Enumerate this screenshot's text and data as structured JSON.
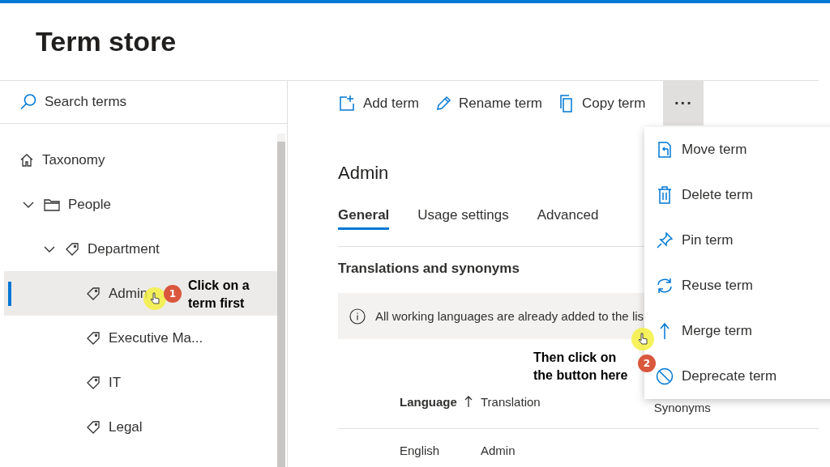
{
  "header": {
    "title": "Term store"
  },
  "sidebar": {
    "search": {
      "placeholder": "Search terms"
    },
    "tree": [
      {
        "label": "Taxonomy",
        "kind": "root",
        "selected": false
      },
      {
        "label": "People",
        "kind": "folder",
        "selected": false,
        "expanded": true,
        "children": [
          {
            "label": "Department",
            "kind": "termset",
            "selected": false,
            "expanded": true,
            "children": [
              {
                "label": "Admin",
                "kind": "term",
                "selected": true
              },
              {
                "label": "Executive Ma...",
                "kind": "term",
                "selected": false
              },
              {
                "label": "IT",
                "kind": "term",
                "selected": false
              },
              {
                "label": "Legal",
                "kind": "term",
                "selected": false
              }
            ]
          }
        ]
      }
    ]
  },
  "toolbar": {
    "actions": [
      {
        "label": "Add term",
        "kind": "add"
      },
      {
        "label": "Rename term",
        "kind": "rename"
      },
      {
        "label": "Copy term",
        "kind": "copy"
      }
    ],
    "more": {
      "label": "···",
      "expanded": true
    }
  },
  "detail": {
    "title": "Admin",
    "tabs": [
      {
        "label": "General",
        "selected": true
      },
      {
        "label": "Usage settings",
        "selected": false
      },
      {
        "label": "Advanced",
        "selected": false
      }
    ],
    "section_title": "Translations and synonyms",
    "info": "All working languages are already added to the lis",
    "table": {
      "columns": [
        {
          "label": "Language",
          "sorted": true
        },
        {
          "label": "Translation",
          "sorted": false
        },
        {
          "label": "Synonyms",
          "sorted": false
        }
      ],
      "rows": [
        [
          "English",
          "Admin",
          ""
        ]
      ]
    }
  },
  "menu": {
    "items": [
      {
        "label": "Move term",
        "kind": "move"
      },
      {
        "label": "Delete term",
        "kind": "delete"
      },
      {
        "label": "Pin term",
        "kind": "pin"
      },
      {
        "label": "Reuse term",
        "kind": "reuse"
      },
      {
        "label": "Merge term",
        "kind": "merge"
      },
      {
        "label": "Deprecate term",
        "kind": "deprecate"
      }
    ]
  },
  "annotations": [
    {
      "number": "1",
      "text": "Click on a term first"
    },
    {
      "number": "2",
      "text": "Then click on the button here"
    }
  ]
}
